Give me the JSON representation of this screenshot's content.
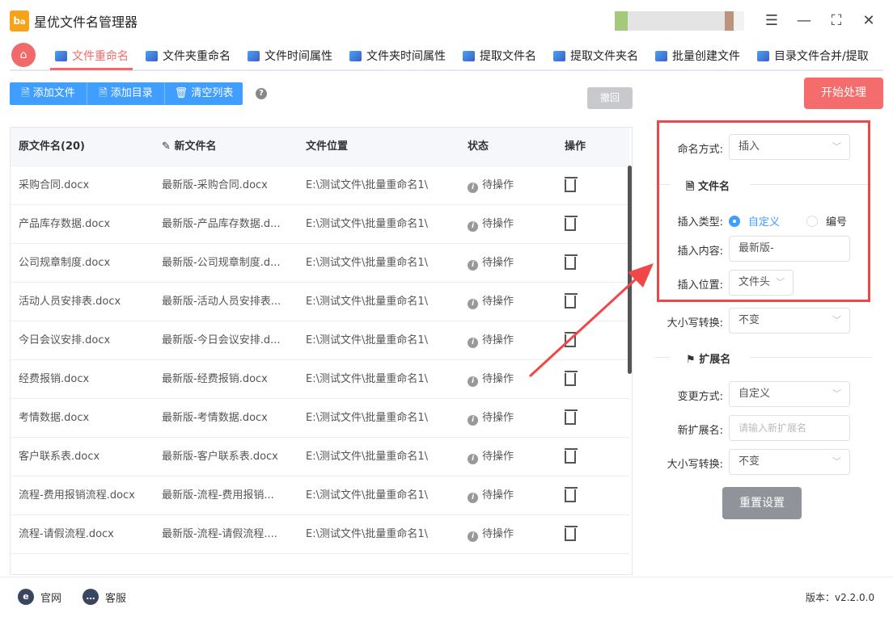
{
  "app": {
    "title": "星优文件名管理器",
    "logo_text": "ba"
  },
  "tabs": [
    {
      "label": "文件重命名",
      "active": true
    },
    {
      "label": "文件夹重命名"
    },
    {
      "label": "文件时间属性"
    },
    {
      "label": "文件夹时间属性"
    },
    {
      "label": "提取文件名"
    },
    {
      "label": "提取文件夹名"
    },
    {
      "label": "批量创建文件"
    },
    {
      "label": "目录文件合并/提取"
    }
  ],
  "toolbar": {
    "add_file": "添加文件",
    "add_dir": "添加目录",
    "clear": "清空列表",
    "help": "?",
    "undo": "撤回",
    "start": "开始处理"
  },
  "table": {
    "headers": [
      "原文件名(20)",
      "新文件名",
      "文件位置",
      "状态",
      "操作"
    ],
    "rows": [
      [
        "采购合同.docx",
        "最新版-采购合同.docx",
        "E:\\测试文件\\批量重命名1\\",
        "待操作"
      ],
      [
        "产品库存数据.docx",
        "最新版-产品库存数据.d...",
        "E:\\测试文件\\批量重命名1\\",
        "待操作"
      ],
      [
        "公司规章制度.docx",
        "最新版-公司规章制度.d...",
        "E:\\测试文件\\批量重命名1\\",
        "待操作"
      ],
      [
        "活动人员安排表.docx",
        "最新版-活动人员安排表...",
        "E:\\测试文件\\批量重命名1\\",
        "待操作"
      ],
      [
        "今日会议安排.docx",
        "最新版-今日会议安排.d...",
        "E:\\测试文件\\批量重命名1\\",
        "待操作"
      ],
      [
        "经费报销.docx",
        "最新版-经费报销.docx",
        "E:\\测试文件\\批量重命名1\\",
        "待操作"
      ],
      [
        "考情数据.docx",
        "最新版-考情数据.docx",
        "E:\\测试文件\\批量重命名1\\",
        "待操作"
      ],
      [
        "客户联系表.docx",
        "最新版-客户联系表.docx",
        "E:\\测试文件\\批量重命名1\\",
        "待操作"
      ],
      [
        "流程-费用报销流程.docx",
        "最新版-流程-费用报销...",
        "E:\\测试文件\\批量重命名1\\",
        "待操作"
      ],
      [
        "流程-请假流程.docx",
        "最新版-流程-请假流程....",
        "E:\\测试文件\\批量重命名1\\",
        "待操作"
      ]
    ]
  },
  "panel": {
    "naming_label": "命名方式:",
    "naming_value": "插入",
    "filename_section": "文件名",
    "insert_type_label": "插入类型:",
    "insert_type_opt1": "自定义",
    "insert_type_opt2": "编号",
    "insert_content_label": "插入内容:",
    "insert_content_value": "最新版-",
    "insert_pos_label": "插入位置:",
    "insert_pos_value": "文件头",
    "case1_label": "大小写转换:",
    "case1_value": "不变",
    "ext_section": "扩展名",
    "ext_mode_label": "变更方式:",
    "ext_mode_value": "自定义",
    "new_ext_label": "新扩展名:",
    "new_ext_placeholder": "请输入新扩展名",
    "case2_label": "大小写转换:",
    "case2_value": "不变",
    "reset": "重置设置"
  },
  "footer": {
    "website": "官网",
    "service": "客服",
    "version": "版本：v2.2.0.0"
  },
  "colors": {
    "accent": "#f06a6a",
    "primary": "#409eff",
    "highlight": "#f04848"
  }
}
